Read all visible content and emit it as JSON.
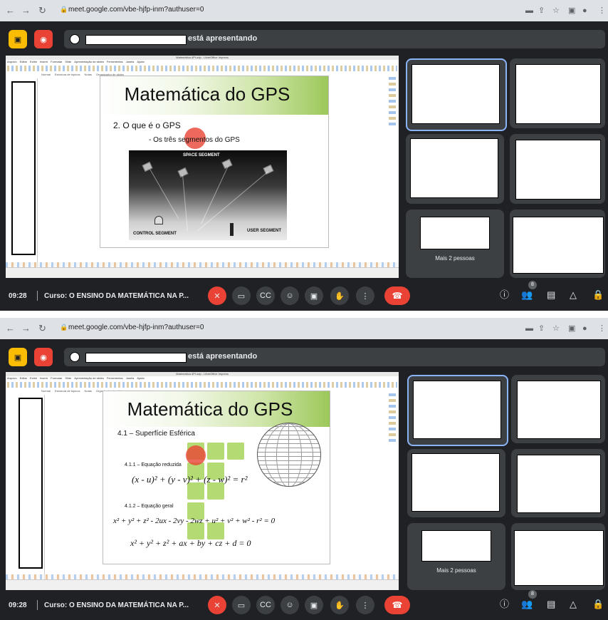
{
  "browser": {
    "url": "meet.google.com/vbe-hjfp-inm?authuser=0",
    "icons": [
      "back-icon",
      "forward-icon",
      "reload-icon",
      "lock-icon",
      "install-icon",
      "share-icon",
      "star-icon",
      "window-icon",
      "profile-icon",
      "menu-icon"
    ]
  },
  "meet": {
    "presenter_suffix": "está apresentando",
    "more_people": "Mais 2 pessoas",
    "clock": "09:28",
    "course": "Curso: O ENSINO DA MATEMÁTICA NA P...",
    "people_badge": "8",
    "colors": {
      "background": "#202124",
      "tile": "#3c4043",
      "danger": "#ea4335",
      "active_border": "#8ab4f8",
      "present_icon": "#fbbc04"
    }
  },
  "impress": {
    "window_title": "Matemática 4Pf.odp - LibreOffice Impress",
    "menus": [
      "Arquivo",
      "Editar",
      "Exibir",
      "Inserir",
      "Formatar",
      "Slide",
      "Apresentação de slides",
      "Ferramentas",
      "Janela",
      "Ajuda"
    ],
    "tabs": [
      "Normal",
      "Estrutura de tópicos",
      "Notas",
      "Organizador de slides"
    ],
    "panel_title": "Slides"
  },
  "slide1": {
    "title": "Matemática do GPS",
    "point": "2. O que é o GPS",
    "subpoint": "- Os três segmentos do GPS",
    "space_segment": "SPACE SEGMENT",
    "control_segment": "CONTROL SEGMENT",
    "user_segment": "USER SEGMENT"
  },
  "slide2": {
    "title": "Matemática do GPS",
    "point": "4.1 – Superfície Esférica",
    "sub1": "4.1.1 – Equação reduzida",
    "eq1": "(x - u)² + (y - v)² + (z - w)² = r²",
    "sub2": "4.1.2 – Equação geral",
    "eq2": "x² + y² + z² - 2ux - 2vy - 2wz + u² + v² + w² - r² = 0",
    "eq3": "x² + y² + z² + ax + by + cz + d = 0"
  }
}
